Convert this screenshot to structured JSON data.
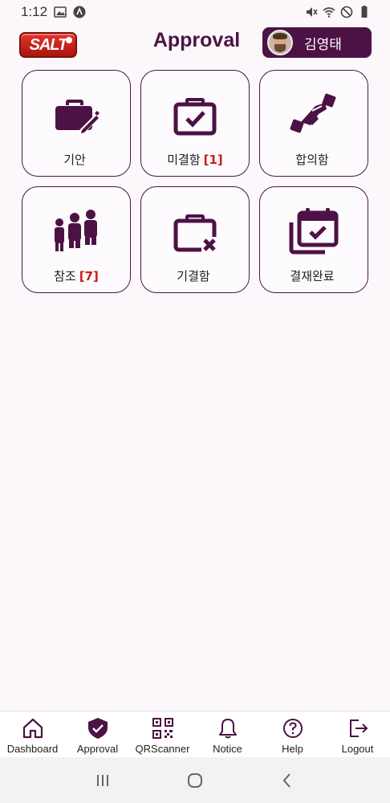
{
  "status_bar": {
    "time": "1:12"
  },
  "header": {
    "logo_text": "SALT",
    "title": "Approval",
    "user_name": "김영태"
  },
  "tiles": [
    {
      "label": "기안",
      "count": "",
      "icon": "briefcase-edit-icon"
    },
    {
      "label": "미결함",
      "count": "[1]",
      "icon": "briefcase-check-icon"
    },
    {
      "label": "합의함",
      "count": "",
      "icon": "handshake-icon"
    },
    {
      "label": "참조",
      "count": "[7]",
      "icon": "people-icon"
    },
    {
      "label": "기결함",
      "count": "",
      "icon": "briefcase-x-icon"
    },
    {
      "label": "결재완료",
      "count": "",
      "icon": "calendar-check-icon"
    }
  ],
  "bottom_nav": [
    {
      "label": "Dashboard",
      "icon": "home-icon"
    },
    {
      "label": "Approval",
      "icon": "shield-check-icon"
    },
    {
      "label": "QRScanner",
      "icon": "qr-icon"
    },
    {
      "label": "Notice",
      "icon": "bell-icon"
    },
    {
      "label": "Help",
      "icon": "help-icon"
    },
    {
      "label": "Logout",
      "icon": "logout-icon"
    }
  ],
  "colors": {
    "accent": "#4d1245",
    "count_red": "#d01a1a",
    "background": "#fbf7fb"
  }
}
